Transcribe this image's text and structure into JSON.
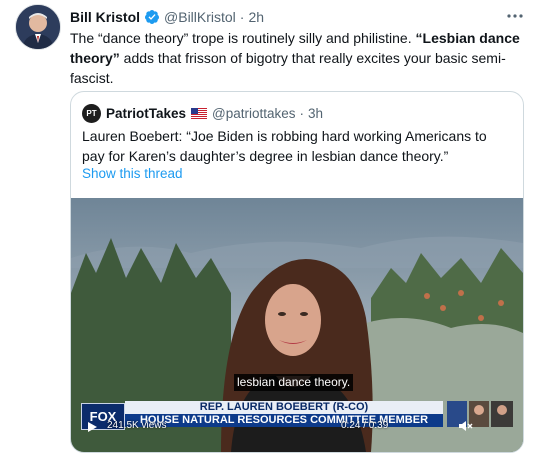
{
  "tweet": {
    "name": "Bill Kristol",
    "handle": "@BillKristol",
    "dot": "·",
    "time": "2h",
    "text_1": "The “dance theory” trope is routinely silly and philistine. ",
    "text_bold": "“Lesbian dance theory”",
    "text_2": " adds that frisson of bigotry that really excites your basic semi-fascist.",
    "more_icon": "more-horizontal-icon",
    "verified_icon": "verified-badge-icon"
  },
  "quote": {
    "avatar_text": "PT",
    "name": "PatriotTakes",
    "flag_icon": "us-flag-icon",
    "handle": "@patriottakes",
    "dot": "·",
    "time": "3h",
    "text": "Lauren Boebert: “Joe Biden is robbing hard working Americans to pay for Karen’s daughter’s degree in lesbian dance theory.”",
    "show_thread": "Show this thread"
  },
  "video": {
    "caption": "lesbian dance theory.",
    "network": "FOX",
    "chyron_name": "REP. LAUREN BOEBERT (R-CO)",
    "chyron_title": "HOUSE NATURAL RESOURCES COMMITTEE MEMBER",
    "views": "241.5K views",
    "duration": "0:24 / 0:39"
  },
  "colors": {
    "link": "#1d9bf0",
    "verified": "#1d9bf0",
    "secondary_text": "#536471",
    "border": "#cfd9de"
  }
}
